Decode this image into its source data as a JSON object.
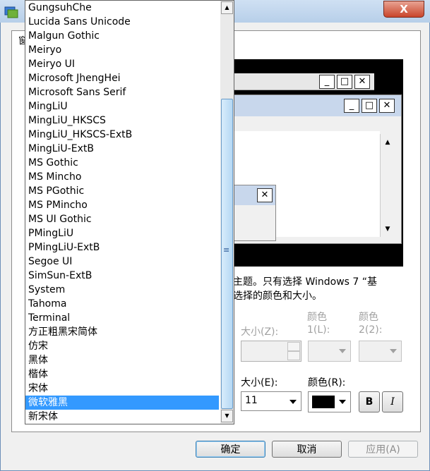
{
  "dialog": {
    "tab_fragment": "窗",
    "close_glyph": "X",
    "preview": {
      "minimize": "_",
      "maximize": "□",
      "close": "✕",
      "scroll_up": "▲",
      "scroll_down": "▼"
    },
    "description_line1": "主题。只有选择 Windows 7 “基",
    "description_line2": "选择的颜色和大小。",
    "item_size_label": "大小(Z):",
    "color1_label_a": "颜色",
    "color1_label_b": "1(L):",
    "color2_label_a": "颜色",
    "color2_label_b": "2(2):",
    "font_size_label": "大小(E):",
    "font_color_label": "颜色(R):",
    "font_size_value": "11",
    "font_color_value": "#000000",
    "bold_label": "B",
    "italic_label": "I",
    "ok_label": "确定",
    "cancel_label": "取消",
    "apply_label": "应用(A)"
  },
  "font_list": {
    "items": [
      "GungsuhChe",
      "Lucida Sans Unicode",
      "Malgun Gothic",
      "Meiryo",
      "Meiryo UI",
      "Microsoft JhengHei",
      "Microsoft Sans Serif",
      "MingLiU",
      "MingLiU_HKSCS",
      "MingLiU_HKSCS-ExtB",
      "MingLiU-ExtB",
      "MS Gothic",
      "MS Mincho",
      "MS PGothic",
      "MS PMincho",
      "MS UI Gothic",
      "PMingLiU",
      "PMingLiU-ExtB",
      "Segoe UI",
      "SimSun-ExtB",
      "System",
      "Tahoma",
      "Terminal",
      "方正粗黑宋简体",
      "仿宋",
      "黑体",
      "楷体",
      "宋体",
      "微软雅黑",
      "新宋体"
    ],
    "selected": "微软雅黑",
    "scroll_up": "▲",
    "scroll_down": "▼",
    "thumb_grip": "≡"
  },
  "colors": {
    "selection": "#3399ff",
    "titlebar": "#b7cfe9",
    "close_button": "#c9452b"
  }
}
